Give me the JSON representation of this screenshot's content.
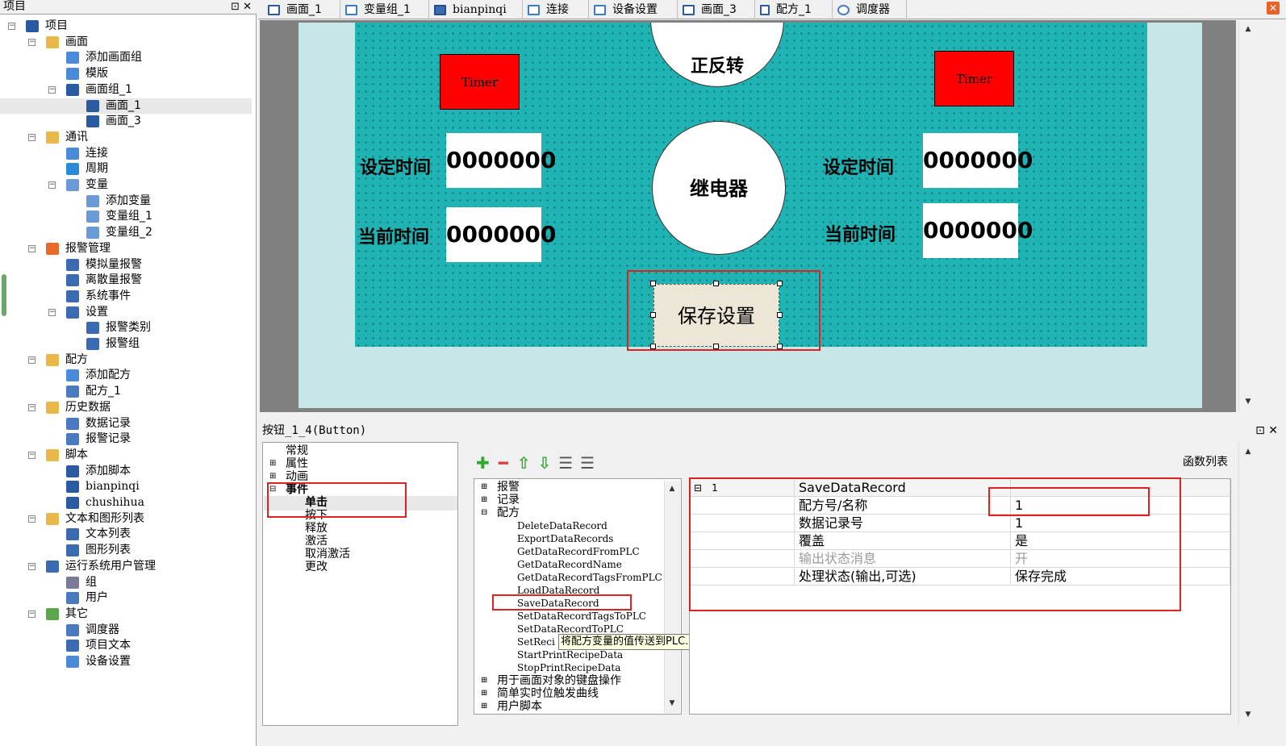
{
  "project_panel": {
    "title": "项目",
    "items": [
      {
        "label": "项目"
      },
      {
        "label": "画面"
      },
      {
        "label": "添加画面组"
      },
      {
        "label": "模版"
      },
      {
        "label": "画面组_1"
      },
      {
        "label": "画面_1"
      },
      {
        "label": "画面_3"
      },
      {
        "label": "通讯"
      },
      {
        "label": "连接"
      },
      {
        "label": "周期"
      },
      {
        "label": "变量"
      },
      {
        "label": "添加变量"
      },
      {
        "label": "变量组_1"
      },
      {
        "label": "变量组_2"
      },
      {
        "label": "报警管理"
      },
      {
        "label": "模拟量报警"
      },
      {
        "label": "离散量报警"
      },
      {
        "label": "系统事件"
      },
      {
        "label": "设置"
      },
      {
        "label": "报警类别"
      },
      {
        "label": "报警组"
      },
      {
        "label": "配方"
      },
      {
        "label": "添加配方"
      },
      {
        "label": "配方_1"
      },
      {
        "label": "历史数据"
      },
      {
        "label": "数据记录"
      },
      {
        "label": "报警记录"
      },
      {
        "label": "脚本"
      },
      {
        "label": "添加脚本"
      },
      {
        "label": "bianpinqi"
      },
      {
        "label": "chushihua"
      },
      {
        "label": "文本和图形列表"
      },
      {
        "label": "文本列表"
      },
      {
        "label": "图形列表"
      },
      {
        "label": "运行系统用户管理"
      },
      {
        "label": "组"
      },
      {
        "label": "用户"
      },
      {
        "label": "其它"
      },
      {
        "label": "调度器"
      },
      {
        "label": "项目文本"
      },
      {
        "label": "设备设置"
      }
    ]
  },
  "tabs": [
    {
      "label": "画面_1"
    },
    {
      "label": "变量组_1"
    },
    {
      "label": "bianpinqi"
    },
    {
      "label": "连接"
    },
    {
      "label": "设备设置"
    },
    {
      "label": "画面_3"
    },
    {
      "label": "配方_1"
    },
    {
      "label": "调度器"
    }
  ],
  "canvas": {
    "top_circle_text": "正反转",
    "timer_left": "Timer",
    "timer_right": "Timer",
    "relay": "继电器",
    "set_time_left": "设定时间",
    "set_time_right": "设定时间",
    "cur_time_left": "当前时间",
    "cur_time_right": "当前时间",
    "val1": "0000000",
    "val2": "0000000",
    "val3": "0000000",
    "val4": "0000000",
    "save_button": "保存设置"
  },
  "properties": {
    "title": "按钮_1_4(Button)",
    "categories": [
      "常规",
      "属性",
      "动画",
      "事件",
      "单击",
      "按下",
      "释放",
      "激活",
      "取消激活",
      "更改"
    ],
    "function_list_label": "函数列表",
    "fn_tree": [
      "报警",
      "记录",
      "配方",
      "DeleteDataRecord",
      "ExportDataRecords",
      "GetDataRecordFromPLC",
      "GetDataRecordName",
      "GetDataRecordTagsFromPLC",
      "LoadDataRecord",
      "SaveDataRecord",
      "SetDataRecordTagsToPLC",
      "SetDataRecordToPLC",
      "SetReci",
      "StartPrintRecipeData",
      "StopPrintRecipeData",
      "用于画面对象的键盘操作",
      "简单实时位触发曲线",
      "用户脚本"
    ],
    "tooltip": "将配方变量的值传送到PLC. 该配方变量包含显示在HMI设备上的数据记录的值",
    "grid": {
      "index": "1",
      "function": "SaveDataRecord",
      "rows": [
        {
          "name": "配方号/名称",
          "value": "1"
        },
        {
          "name": "数据记录号",
          "value": "1"
        },
        {
          "name": "覆盖",
          "value": "是"
        },
        {
          "name": "输出状态消息",
          "value": "开"
        },
        {
          "name": "处理状态(输出,可选)",
          "value": "保存完成"
        }
      ]
    }
  }
}
